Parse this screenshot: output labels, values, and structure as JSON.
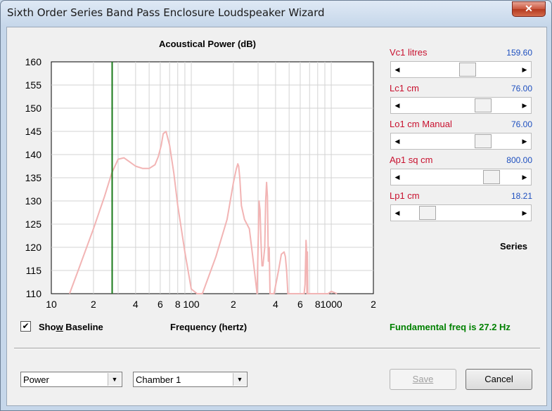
{
  "window": {
    "title": "Sixth Order Series Band Pass Enclosure Loudspeaker Wizard",
    "close_glyph": "✕"
  },
  "chart_title": "Acoustical Power (dB)",
  "chart_data": {
    "type": "line",
    "title": "Acoustical Power (dB)",
    "xlabel": "Frequency (hertz)",
    "ylabel": "",
    "xscale": "log",
    "xlim": [
      10,
      2000
    ],
    "ylim": [
      110,
      160
    ],
    "grid": true,
    "ytick_labels": [
      "160",
      "155",
      "150",
      "145",
      "140",
      "135",
      "130",
      "125",
      "120",
      "115",
      "110"
    ],
    "xtick_labels": [
      "10",
      "2",
      "4",
      "6",
      "8",
      "100",
      "2",
      "4",
      "6",
      "8",
      "1000",
      "2"
    ],
    "marker_freq": 27.2,
    "marker_color": "#1a7a1a",
    "series_color": "#f2b4b4",
    "x": [
      13.5,
      16,
      20,
      24,
      27,
      30,
      33,
      36,
      40,
      45,
      50,
      55,
      58,
      61,
      63,
      66,
      70,
      75,
      80,
      90,
      100,
      110,
      120,
      150,
      180,
      200,
      210,
      215,
      218,
      222,
      228,
      240,
      260,
      280,
      295,
      300,
      305,
      310,
      315,
      320,
      325,
      335,
      340,
      345,
      350,
      355,
      360,
      365,
      390,
      420,
      440,
      460,
      470,
      480,
      490,
      640,
      650,
      660,
      665,
      670,
      675,
      680,
      700,
      900,
      950,
      1000,
      1100
    ],
    "y": [
      110,
      116,
      124,
      131,
      136,
      139,
      139.3,
      138.5,
      137.5,
      137,
      137,
      137.8,
      139.5,
      142,
      144.5,
      145,
      142,
      136,
      129,
      119,
      111,
      110,
      110,
      118,
      126,
      134,
      137,
      138,
      137.5,
      135,
      129,
      126,
      124,
      116,
      110,
      120,
      130,
      128,
      121,
      116,
      116,
      120,
      130,
      134,
      131,
      117,
      120,
      110,
      110,
      115,
      118.5,
      119,
      118,
      115,
      110,
      110,
      112,
      121.5,
      120,
      110,
      119,
      110,
      110,
      110,
      110,
      110.5,
      110
    ]
  },
  "params": [
    {
      "label": "Vc1  litres",
      "value": "159.60",
      "thumb_pct": 57
    },
    {
      "label": "Lc1  cm",
      "value": "76.00",
      "thumb_pct": 73
    },
    {
      "label": "Lo1  cm  Manual",
      "value": "76.00",
      "thumb_pct": 73
    },
    {
      "label": "Ap1  sq cm",
      "value": "800.00",
      "thumb_pct": 81
    },
    {
      "label": "Lp1  cm",
      "value": "18.21",
      "thumb_pct": 16
    }
  ],
  "series_label": "Series",
  "show_baseline": {
    "label_pre": "Sho",
    "label_ul": "w",
    "label_post": " Baseline",
    "checked": true,
    "check_glyph": "✔"
  },
  "xaxis_label": "Frequency (hertz)",
  "fundamental_text": "Fundamental freq is 27.2 Hz",
  "selectors": {
    "view": {
      "value": "Power"
    },
    "chamber": {
      "value": "Chamber 1"
    }
  },
  "buttons": {
    "save": "Save",
    "cancel": "Cancel"
  },
  "colors": {
    "label_red": "#c8102e",
    "value_blue": "#1d4fbf",
    "fundamental_green": "#008000"
  }
}
